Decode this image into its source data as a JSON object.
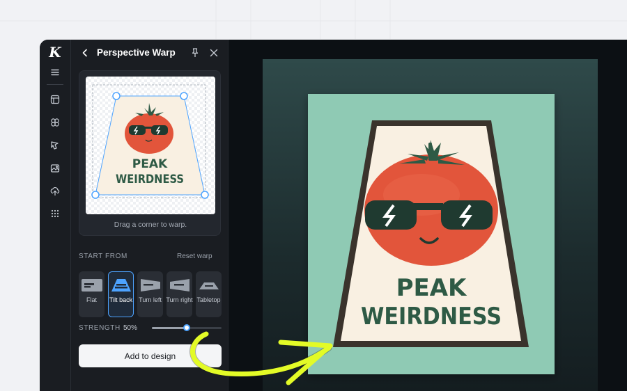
{
  "panel": {
    "title": "Perspective Warp",
    "preview_hint": "Drag a corner to warp.",
    "section_label": "START FROM",
    "reset_label": "Reset warp",
    "presets": [
      {
        "label": "Flat",
        "icon": "flat-preset-icon"
      },
      {
        "label": "Tilt back",
        "icon": "tilt-back-preset-icon",
        "active": true
      },
      {
        "label": "Turn left",
        "icon": "turn-left-preset-icon"
      },
      {
        "label": "Turn right",
        "icon": "turn-right-preset-icon"
      },
      {
        "label": "Tabletop",
        "icon": "tabletop-preset-icon"
      }
    ],
    "strength_label": "STRENGTH",
    "strength_value": "50%",
    "strength_percent": 50,
    "add_button": "Add to design"
  },
  "artwork": {
    "line1": "PEAK",
    "line2": "WEIRDNESS"
  },
  "rail": {
    "logo": "K",
    "icons": [
      "menu-icon",
      "templates-icon",
      "elements-icon",
      "magic-icon",
      "photos-icon",
      "upload-icon",
      "apps-icon"
    ]
  },
  "colors": {
    "accent": "#4da3ff",
    "tomato": "#e2553b",
    "leaf": "#2e5a45",
    "poster_bg": "#f9f0e2",
    "mint": "#8fcab4",
    "arrow": "#e3fb27"
  }
}
